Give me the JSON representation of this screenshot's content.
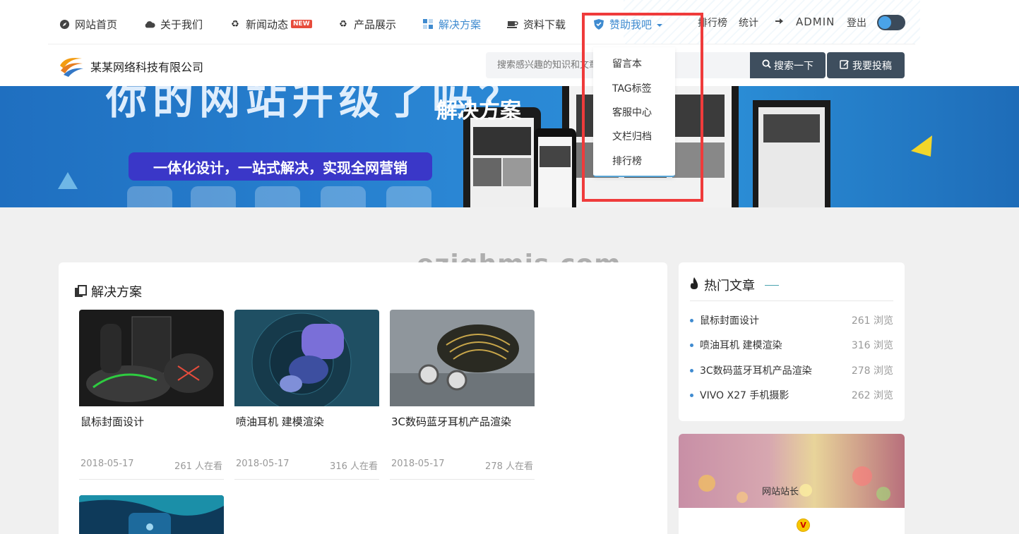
{
  "nav": {
    "items": [
      {
        "label": "网站首页",
        "icon": "compass-icon"
      },
      {
        "label": "关于我们",
        "icon": "cloud-icon"
      },
      {
        "label": "新闻动态",
        "icon": "recycle-icon",
        "badge": "NEW"
      },
      {
        "label": "产品展示",
        "icon": "recycle-icon"
      },
      {
        "label": "解决方案",
        "icon": "grid-icon",
        "active": true
      },
      {
        "label": "资料下载",
        "icon": "coffee-icon"
      },
      {
        "label": "赞助我吧",
        "icon": "shield-icon"
      }
    ],
    "dropdown": [
      "留言本",
      "TAG标签",
      "客服中心",
      "文栏归档",
      "排行榜"
    ],
    "right": {
      "rank": "排行榜",
      "stats": "统计",
      "admin": "ADMIN",
      "logout": "登出"
    }
  },
  "header": {
    "site_name": "某某网络科技有限公司",
    "search_placeholder": "搜索感兴趣的知识和文章",
    "search_button": "搜索一下",
    "post_button": "我要投稿"
  },
  "banner": {
    "big_text": "你的网站升级了吗？",
    "slogan": "一体化设计，一站式解决，实现全网营销",
    "page_title": "解决方案"
  },
  "watermark": "ezighmis.com",
  "main": {
    "section_title": "解决方案",
    "posts": [
      {
        "title": "鼠标封面设计",
        "date": "2018-05-17",
        "views": "261 人在看"
      },
      {
        "title": "喷油耳机 建模渲染",
        "date": "2018-05-17",
        "views": "316 人在看"
      },
      {
        "title": "3C数码蓝牙耳机产品渲染",
        "date": "2018-05-17",
        "views": "278 人在看"
      }
    ]
  },
  "sidebar": {
    "hot_title": "热门文章",
    "hot": [
      {
        "title": "鼠标封面设计",
        "views": "261 浏览"
      },
      {
        "title": "喷油耳机 建模渲染",
        "views": "316 浏览"
      },
      {
        "title": "3C数码蓝牙耳机产品渲染",
        "views": "278 浏览"
      },
      {
        "title": "VIVO X27 手机摄影",
        "views": "262 浏览"
      }
    ],
    "profile_alt": "网站站长",
    "profile_badge": "V"
  },
  "colors": {
    "accent": "#3f8bd0",
    "dark_button": "#3e4e5e",
    "highlight": "#ef3b3b",
    "new_badge": "#e74c3c"
  }
}
